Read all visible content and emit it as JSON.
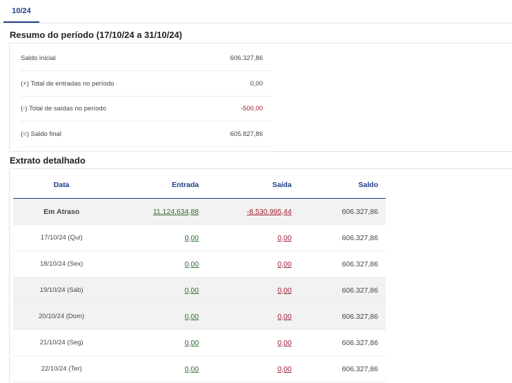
{
  "tabs": [
    {
      "label": "10/24"
    }
  ],
  "summary": {
    "title": "Resumo do período (17/10/24 a 31/10/24)",
    "rows": [
      {
        "label": "Saldo inicial",
        "value": "606.327,86"
      },
      {
        "label": "(+) Total de entradas no período",
        "value": "0,00"
      },
      {
        "label": "(-) Total de saídas no período",
        "value": "-500,00"
      },
      {
        "label": "(=) Saldo final",
        "value": "605.827,86"
      }
    ]
  },
  "statement": {
    "title": "Extrato detalhado",
    "columns": {
      "date": "Data",
      "in": "Entrada",
      "out": "Saída",
      "balance": "Saldo"
    },
    "rows": [
      {
        "date": "Em Atraso",
        "in": "11.124.634,88",
        "out": "-8.530.995,44",
        "balance": "606.327,86"
      },
      {
        "date": "17/10/24 (Qui)",
        "in": "0,00",
        "out": "0,00",
        "balance": "606.327,86"
      },
      {
        "date": "18/10/24 (Sex)",
        "in": "0,00",
        "out": "0,00",
        "balance": "606.327,86"
      },
      {
        "date": "19/10/24 (Sáb)",
        "in": "0,00",
        "out": "0,00",
        "balance": "606.327,86"
      },
      {
        "date": "20/10/24 (Dom)",
        "in": "0,00",
        "out": "0,00",
        "balance": "606.327,86"
      },
      {
        "date": "21/10/24 (Seg)",
        "in": "0,00",
        "out": "0,00",
        "balance": "606.327,86"
      },
      {
        "date": "22/10/24 (Ter)",
        "in": "0,00",
        "out": "0,00",
        "balance": "606.327,86"
      }
    ]
  },
  "colors": {
    "accent": "#1f3c88",
    "positive": "#2e6b2e",
    "negative": "#9b1b30",
    "shaded_row": "#f2f2f2"
  }
}
